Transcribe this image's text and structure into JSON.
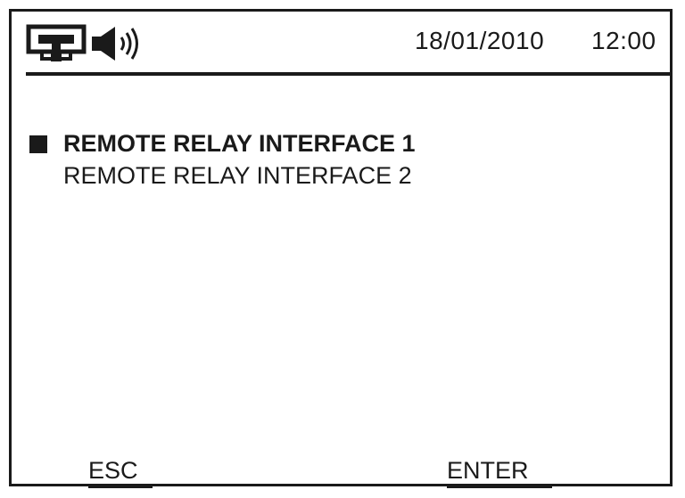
{
  "status_bar": {
    "icons": [
      "network-icon",
      "speaker-icon"
    ],
    "date": "18/01/2010",
    "time": "12:00"
  },
  "menu": {
    "items": [
      {
        "label": "REMOTE RELAY INTERFACE 1",
        "selected": true
      },
      {
        "label": "REMOTE RELAY INTERFACE 2",
        "selected": false
      }
    ]
  },
  "softkeys": {
    "left_label": "ESC",
    "right_label": "ENTER"
  },
  "colors": {
    "foreground": "#1a1a1a",
    "background": "#ffffff"
  }
}
